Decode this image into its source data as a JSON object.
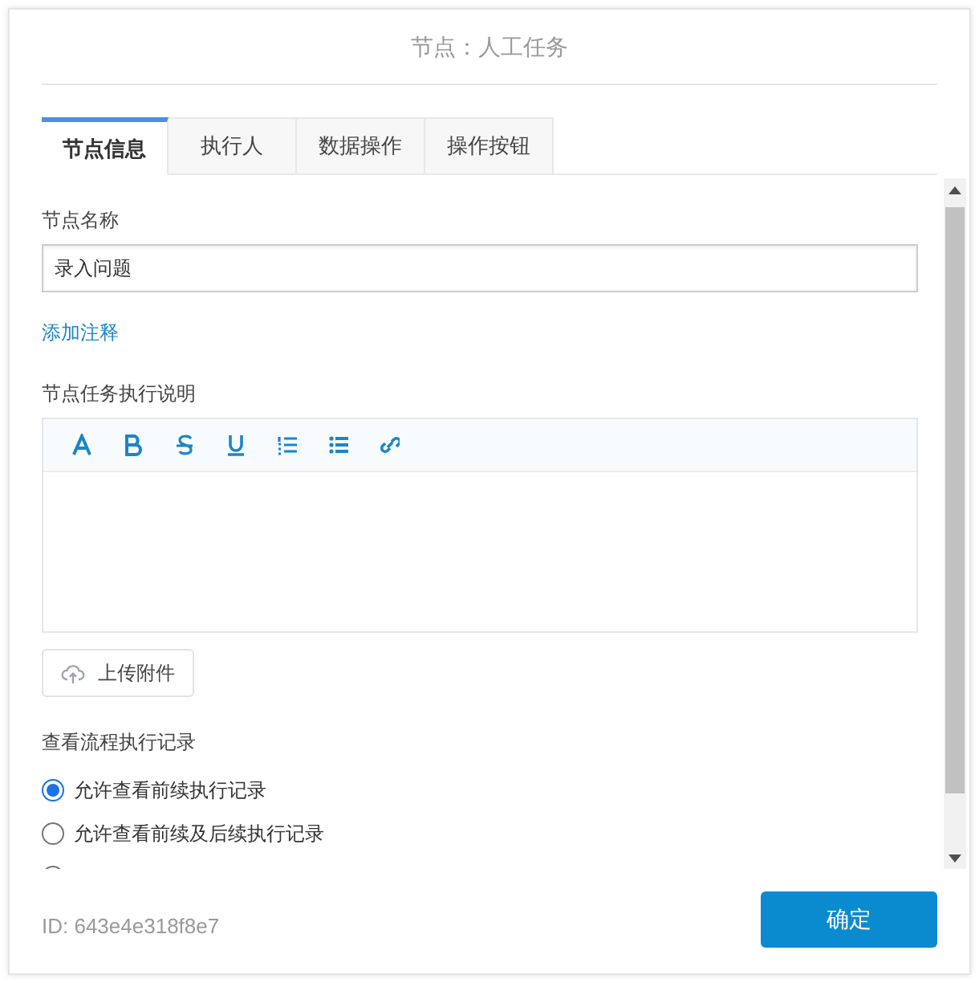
{
  "dialog": {
    "title": "节点：人工任务"
  },
  "tabs": [
    {
      "label": "节点信息",
      "selected": true
    },
    {
      "label": "执行人",
      "selected": false
    },
    {
      "label": "数据操作",
      "selected": false
    },
    {
      "label": "操作按钮",
      "selected": false
    }
  ],
  "node_name": {
    "label": "节点名称",
    "value": "录入问题"
  },
  "add_note_link": "添加注释",
  "description": {
    "label": "节点任务执行说明",
    "toolbar": [
      {
        "kind": "font"
      },
      {
        "kind": "bold"
      },
      {
        "kind": "strike"
      },
      {
        "kind": "underline"
      },
      {
        "kind": "ordered"
      },
      {
        "kind": "bullets"
      },
      {
        "kind": "link"
      }
    ]
  },
  "upload_button": "上传附件",
  "history": {
    "label": "查看流程执行记录",
    "options": [
      {
        "label": "允许查看前续执行记录",
        "selected": true
      },
      {
        "label": "允许查看前续及后续执行记录",
        "selected": false
      },
      {
        "selected": false
      }
    ]
  },
  "footer": {
    "id_text": "ID: 643e4e318f8e7",
    "confirm_button": "确定"
  }
}
